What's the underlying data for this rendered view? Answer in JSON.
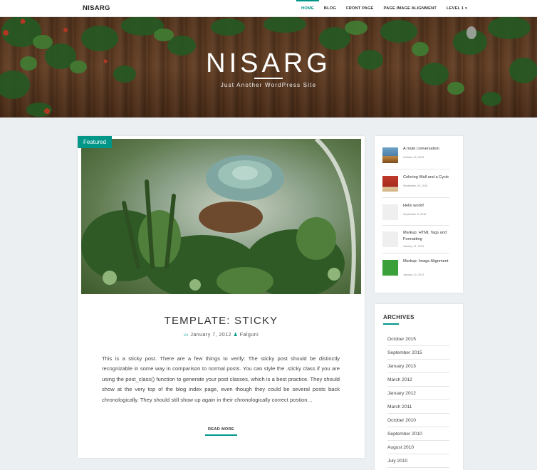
{
  "nav": {
    "brand": "NISARG",
    "items": [
      {
        "label": "HOME"
      },
      {
        "label": "BLOG"
      },
      {
        "label": "FRONT PAGE"
      },
      {
        "label": "PAGE IMAGE ALIGNMENT"
      },
      {
        "label": "LEVEL 1"
      }
    ],
    "caret": "▾"
  },
  "hero": {
    "title": "NISARG",
    "subtitle": "Just Another WordPress Site"
  },
  "post": {
    "badge": "Featured",
    "title": "TEMPLATE: STICKY",
    "date": "January 7, 2012",
    "author": "Falguni",
    "date_icon": "▭",
    "author_icon": "♟",
    "excerpt": "This is a sticky post. There are a few things to verify: The sticky post should be distinctly recognizable in some way in comparison to normal posts. You can style the .sticky class if you are using the post_class() function to generate your post classes, which is a best practice. They should show at the very top of the blog index page, even though they could be several posts back chronologically. They should still show up again in their chronologically correct postion…",
    "read_more": "READ MORE"
  },
  "recent_posts": [
    {
      "title": "A mute conversation",
      "date": "October 15, 2015"
    },
    {
      "title": "Coloring Wall and a Cycle",
      "date": "September 28, 2015"
    },
    {
      "title": "Hello world!",
      "date": "September 8, 2015"
    },
    {
      "title": "Markup: HTML Tags and Formatting",
      "date": "January 11, 2013"
    },
    {
      "title": "Markup: Image Alignment",
      "date": "January 10, 2013"
    }
  ],
  "archives": {
    "title": "ARCHIVES",
    "items": [
      "October 2015",
      "September 2015",
      "January 2013",
      "March 2012",
      "January 2012",
      "March 2011",
      "October 2010",
      "September 2010",
      "August 2010",
      "July 2010"
    ]
  },
  "colors": {
    "accent": "#009688"
  }
}
